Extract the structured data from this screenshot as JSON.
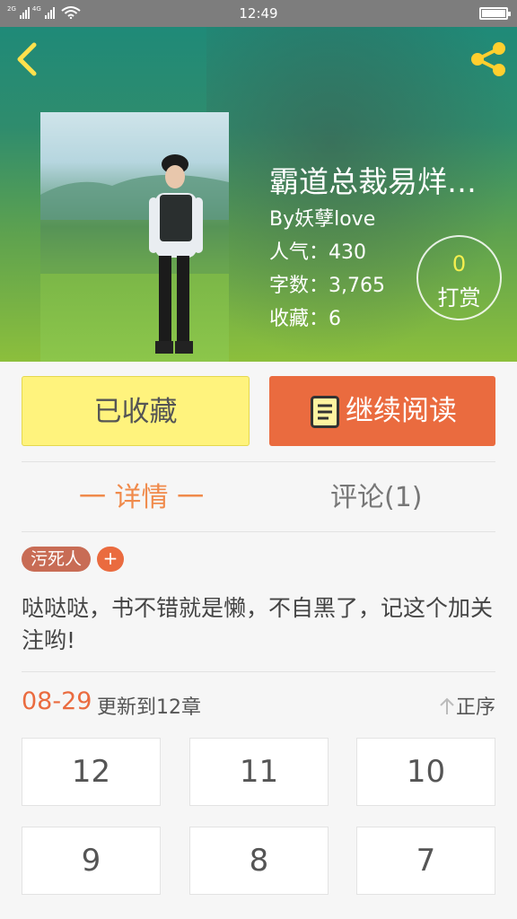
{
  "status": {
    "network_left": "2G",
    "network_right": "4G",
    "time": "12:49"
  },
  "book": {
    "title": "霸道总裁易烊…",
    "author": "By妖孽love",
    "popularity": "人气：430",
    "word_count": "字数：3,765",
    "favorites": "收藏：6",
    "reward_count": "0",
    "reward_label": "打赏"
  },
  "actions": {
    "favorited_label": "已收藏",
    "continue_label": "继续阅读"
  },
  "tabs": {
    "detail": "一 详情 一",
    "comments": "评论(1)"
  },
  "tag": "污死人",
  "tag_add": "+",
  "description": "哒哒哒，书不错就是懒，不自黑了，记这个加关注哟!",
  "update": {
    "date": "08-29",
    "text": "更新到12章",
    "order_label": "正序"
  },
  "chapters": [
    "12",
    "11",
    "10",
    "9",
    "8",
    "7"
  ],
  "colors": {
    "accent": "#ea6b3f",
    "favorite_bg": "#fff37d",
    "tab_active": "#f08a4b"
  }
}
